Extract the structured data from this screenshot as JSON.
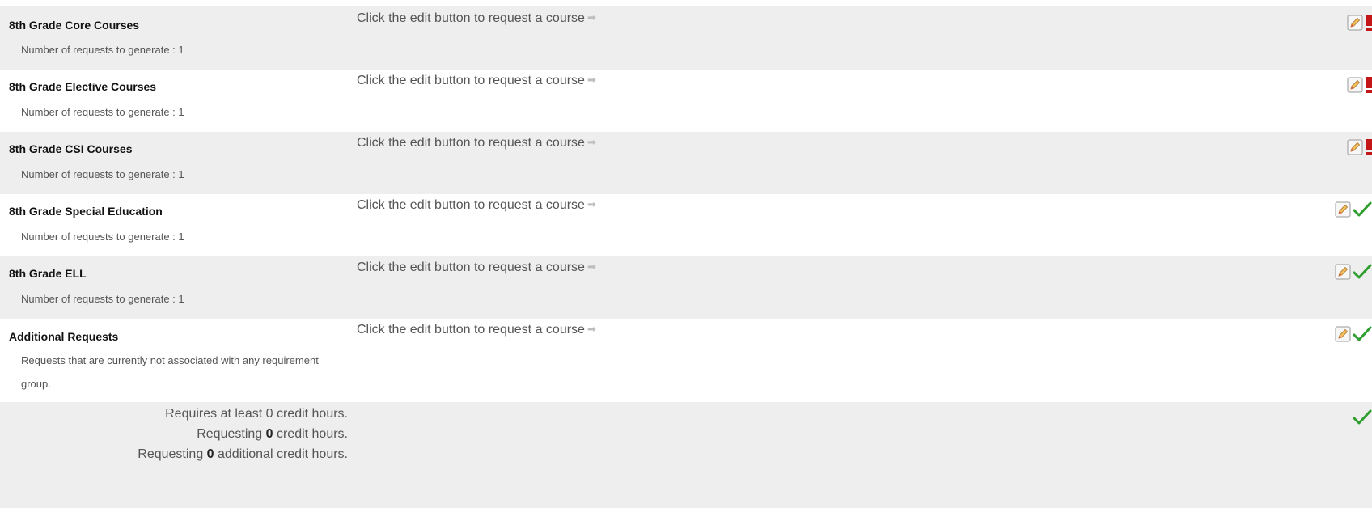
{
  "instruction_text": "Click the edit button to request a course",
  "arrow_glyph": "➡",
  "groups": [
    {
      "title": "8th Grade Core Courses",
      "desc": "Number of requests to generate : 1",
      "status": "error"
    },
    {
      "title": "8th Grade Elective Courses",
      "desc": "Number of requests to generate : 1",
      "status": "error"
    },
    {
      "title": "8th Grade CSI Courses",
      "desc": "Number of requests to generate : 1",
      "status": "error"
    },
    {
      "title": "8th Grade Special Education",
      "desc": "Number of requests to generate : 1",
      "status": "ok"
    },
    {
      "title": "8th Grade ELL",
      "desc": "Number of requests to generate : 1",
      "status": "ok"
    },
    {
      "title": "Additional Requests",
      "desc": "Requests that are currently not associated with any requirement group.",
      "status": "ok"
    }
  ],
  "summary": {
    "line1": "Requires at least 0 credit hours.",
    "line2_prefix": "Requesting ",
    "line2_value": "0",
    "line2_suffix": " credit hours.",
    "line3_prefix": "Requesting ",
    "line3_value": "0",
    "line3_suffix": " additional credit hours.",
    "status": "ok"
  },
  "colors": {
    "ok": "#2e9e2e",
    "error": "#c41616",
    "shaded_row": "#eeeeee"
  },
  "icons": {
    "edit": "edit-pencil-icon",
    "ok": "checkmark-icon",
    "error": "exclamation-icon",
    "arrow": "right-arrow-icon"
  }
}
